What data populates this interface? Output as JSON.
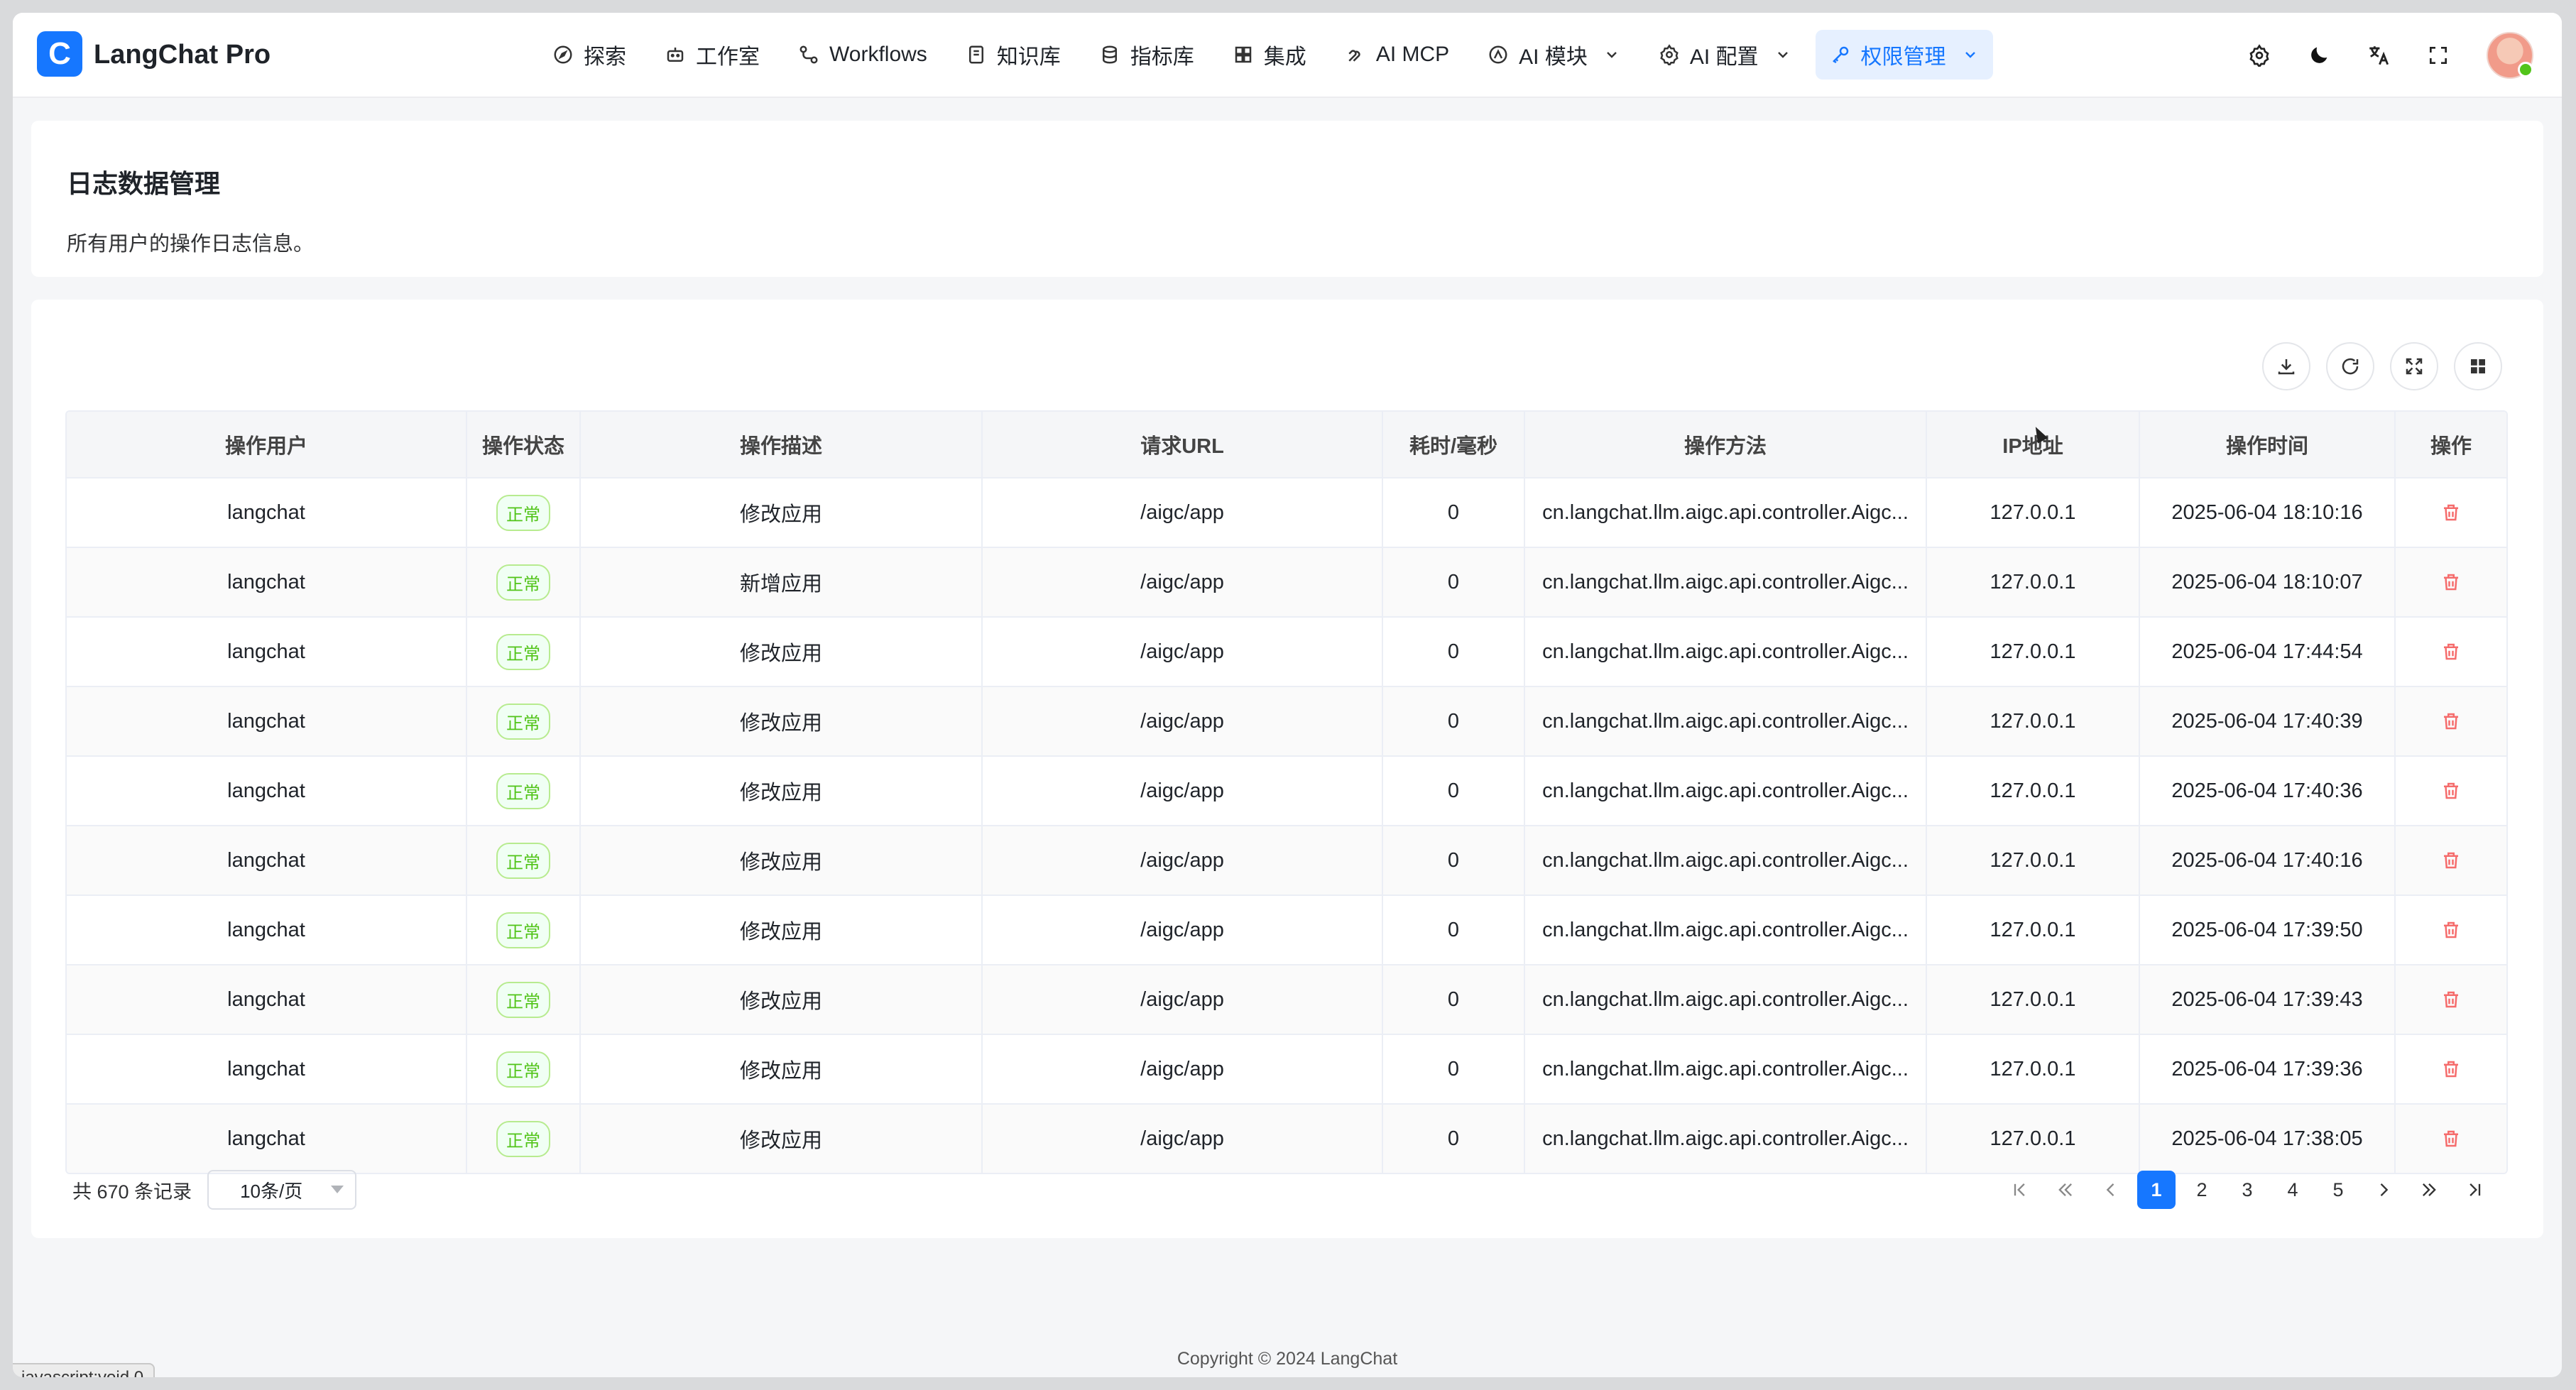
{
  "app": {
    "logo_letter": "C",
    "name": "LangChat Pro"
  },
  "nav": [
    {
      "label": "探索",
      "icon": "compass-icon"
    },
    {
      "label": "工作室",
      "icon": "robot-icon"
    },
    {
      "label": "Workflows",
      "icon": "workflow-icon"
    },
    {
      "label": "知识库",
      "icon": "book-icon"
    },
    {
      "label": "指标库",
      "icon": "database-icon"
    },
    {
      "label": "集成",
      "icon": "grid-icon"
    },
    {
      "label": "AI MCP",
      "icon": "mcp-icon"
    },
    {
      "label": "AI 模块",
      "icon": "module-icon",
      "has_dropdown": true
    },
    {
      "label": "AI 配置",
      "icon": "gear-icon",
      "has_dropdown": true
    },
    {
      "label": "权限管理",
      "icon": "key-icon",
      "has_dropdown": true,
      "active": true
    }
  ],
  "header_tools": [
    "settings-icon",
    "moon-icon",
    "translate-icon",
    "fullscreen-icon"
  ],
  "page": {
    "title": "日志数据管理",
    "description": "所有用户的操作日志信息。"
  },
  "table_tools": [
    "download-icon",
    "refresh-icon",
    "expand-icon",
    "layout-icon"
  ],
  "table": {
    "columns": [
      "操作用户",
      "操作状态",
      "操作描述",
      "请求URL",
      "耗时/毫秒",
      "操作方法",
      "IP地址",
      "操作时间",
      "操作"
    ],
    "rows": [
      {
        "user": "langchat",
        "status": "正常",
        "desc": "修改应用",
        "url": "/aigc/app",
        "ms": "0",
        "method": "cn.langchat.llm.aigc.api.controller.Aigc...",
        "ip": "127.0.0.1",
        "time": "2025-06-04 18:10:16"
      },
      {
        "user": "langchat",
        "status": "正常",
        "desc": "新增应用",
        "url": "/aigc/app",
        "ms": "0",
        "method": "cn.langchat.llm.aigc.api.controller.Aigc...",
        "ip": "127.0.0.1",
        "time": "2025-06-04 18:10:07"
      },
      {
        "user": "langchat",
        "status": "正常",
        "desc": "修改应用",
        "url": "/aigc/app",
        "ms": "0",
        "method": "cn.langchat.llm.aigc.api.controller.Aigc...",
        "ip": "127.0.0.1",
        "time": "2025-06-04 17:44:54"
      },
      {
        "user": "langchat",
        "status": "正常",
        "desc": "修改应用",
        "url": "/aigc/app",
        "ms": "0",
        "method": "cn.langchat.llm.aigc.api.controller.Aigc...",
        "ip": "127.0.0.1",
        "time": "2025-06-04 17:40:39"
      },
      {
        "user": "langchat",
        "status": "正常",
        "desc": "修改应用",
        "url": "/aigc/app",
        "ms": "0",
        "method": "cn.langchat.llm.aigc.api.controller.Aigc...",
        "ip": "127.0.0.1",
        "time": "2025-06-04 17:40:36"
      },
      {
        "user": "langchat",
        "status": "正常",
        "desc": "修改应用",
        "url": "/aigc/app",
        "ms": "0",
        "method": "cn.langchat.llm.aigc.api.controller.Aigc...",
        "ip": "127.0.0.1",
        "time": "2025-06-04 17:40:16"
      },
      {
        "user": "langchat",
        "status": "正常",
        "desc": "修改应用",
        "url": "/aigc/app",
        "ms": "0",
        "method": "cn.langchat.llm.aigc.api.controller.Aigc...",
        "ip": "127.0.0.1",
        "time": "2025-06-04 17:39:50"
      },
      {
        "user": "langchat",
        "status": "正常",
        "desc": "修改应用",
        "url": "/aigc/app",
        "ms": "0",
        "method": "cn.langchat.llm.aigc.api.controller.Aigc...",
        "ip": "127.0.0.1",
        "time": "2025-06-04 17:39:43"
      },
      {
        "user": "langchat",
        "status": "正常",
        "desc": "修改应用",
        "url": "/aigc/app",
        "ms": "0",
        "method": "cn.langchat.llm.aigc.api.controller.Aigc...",
        "ip": "127.0.0.1",
        "time": "2025-06-04 17:39:36"
      },
      {
        "user": "langchat",
        "status": "正常",
        "desc": "修改应用",
        "url": "/aigc/app",
        "ms": "0",
        "method": "cn.langchat.llm.aigc.api.controller.Aigc...",
        "ip": "127.0.0.1",
        "time": "2025-06-04 17:38:05"
      }
    ]
  },
  "pagination": {
    "total_text": "共 670 条记录",
    "page_size": "10条/页",
    "pages": [
      "1",
      "2",
      "3",
      "4",
      "5"
    ],
    "current": "1"
  },
  "footer": {
    "copyright": "Copyright © 2024 LangChat"
  },
  "statusbar": {
    "text": "javascript:void 0"
  },
  "colors": {
    "accent": "#1677ff",
    "status_ok": "#52c41a",
    "danger": "#f56c6c"
  }
}
